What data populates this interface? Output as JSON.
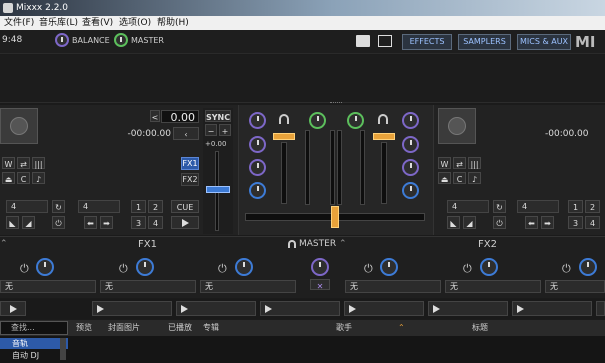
{
  "window": {
    "title": "Mixxx 2.2.0"
  },
  "menu": [
    "文件(F)",
    "音乐库(L)",
    "查看(V)",
    "选项(O)",
    "帮助(H)"
  ],
  "toolbar": {
    "clock": "9:48",
    "balance_label": "BALANCE",
    "master_label": "MASTER",
    "effects": "EFFECTS",
    "samplers": "SAMPLERS",
    "mics_aux": "MICS & AUX",
    "logo_text": "MI"
  },
  "deck_left": {
    "bpm": "0.00",
    "time": "-00:00.00",
    "rate": "+0.00",
    "sync": "SYNC",
    "minus": "−",
    "plus": "+",
    "fx1": "FX1",
    "fx2": "FX2",
    "loop_size_1": "4",
    "loop_size_2": "4",
    "hotcues": [
      "1",
      "2",
      "3",
      "4"
    ],
    "cue": "CUE"
  },
  "deck_right": {
    "time": "-00:00.00",
    "loop_size_1": "4",
    "loop_size_2": "4",
    "hotcues": [
      "1",
      "2",
      "3",
      "4"
    ]
  },
  "effects": {
    "unit1": "FX1",
    "unit2": "FX2",
    "master": "MASTER",
    "slot_none": "无"
  },
  "library": {
    "search_placeholder": "查找...",
    "columns": [
      "预览",
      "封面图片",
      "已播放",
      "专辑",
      "歌手",
      "标题"
    ],
    "tree_items": [
      "音轨",
      "自动 DJ"
    ]
  },
  "colors": {
    "accent_blue": "#2d5aa8",
    "accent_orange": "#e8a23a",
    "knob_purple": "#7d67c7",
    "knob_blue": "#3d7bd6",
    "knob_green": "#5cbf5c"
  }
}
